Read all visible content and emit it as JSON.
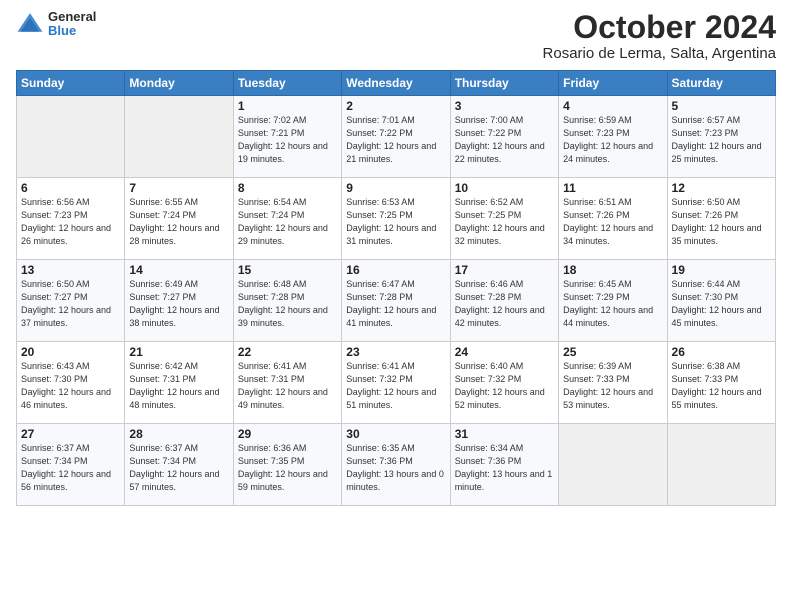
{
  "header": {
    "logo_general": "General",
    "logo_blue": "Blue",
    "title": "October 2024",
    "subtitle": "Rosario de Lerma, Salta, Argentina"
  },
  "weekdays": [
    "Sunday",
    "Monday",
    "Tuesday",
    "Wednesday",
    "Thursday",
    "Friday",
    "Saturday"
  ],
  "weeks": [
    [
      {
        "day": "",
        "info": ""
      },
      {
        "day": "",
        "info": ""
      },
      {
        "day": "1",
        "info": "Sunrise: 7:02 AM\nSunset: 7:21 PM\nDaylight: 12 hours and 19 minutes."
      },
      {
        "day": "2",
        "info": "Sunrise: 7:01 AM\nSunset: 7:22 PM\nDaylight: 12 hours and 21 minutes."
      },
      {
        "day": "3",
        "info": "Sunrise: 7:00 AM\nSunset: 7:22 PM\nDaylight: 12 hours and 22 minutes."
      },
      {
        "day": "4",
        "info": "Sunrise: 6:59 AM\nSunset: 7:23 PM\nDaylight: 12 hours and 24 minutes."
      },
      {
        "day": "5",
        "info": "Sunrise: 6:57 AM\nSunset: 7:23 PM\nDaylight: 12 hours and 25 minutes."
      }
    ],
    [
      {
        "day": "6",
        "info": "Sunrise: 6:56 AM\nSunset: 7:23 PM\nDaylight: 12 hours and 26 minutes."
      },
      {
        "day": "7",
        "info": "Sunrise: 6:55 AM\nSunset: 7:24 PM\nDaylight: 12 hours and 28 minutes."
      },
      {
        "day": "8",
        "info": "Sunrise: 6:54 AM\nSunset: 7:24 PM\nDaylight: 12 hours and 29 minutes."
      },
      {
        "day": "9",
        "info": "Sunrise: 6:53 AM\nSunset: 7:25 PM\nDaylight: 12 hours and 31 minutes."
      },
      {
        "day": "10",
        "info": "Sunrise: 6:52 AM\nSunset: 7:25 PM\nDaylight: 12 hours and 32 minutes."
      },
      {
        "day": "11",
        "info": "Sunrise: 6:51 AM\nSunset: 7:26 PM\nDaylight: 12 hours and 34 minutes."
      },
      {
        "day": "12",
        "info": "Sunrise: 6:50 AM\nSunset: 7:26 PM\nDaylight: 12 hours and 35 minutes."
      }
    ],
    [
      {
        "day": "13",
        "info": "Sunrise: 6:50 AM\nSunset: 7:27 PM\nDaylight: 12 hours and 37 minutes."
      },
      {
        "day": "14",
        "info": "Sunrise: 6:49 AM\nSunset: 7:27 PM\nDaylight: 12 hours and 38 minutes."
      },
      {
        "day": "15",
        "info": "Sunrise: 6:48 AM\nSunset: 7:28 PM\nDaylight: 12 hours and 39 minutes."
      },
      {
        "day": "16",
        "info": "Sunrise: 6:47 AM\nSunset: 7:28 PM\nDaylight: 12 hours and 41 minutes."
      },
      {
        "day": "17",
        "info": "Sunrise: 6:46 AM\nSunset: 7:28 PM\nDaylight: 12 hours and 42 minutes."
      },
      {
        "day": "18",
        "info": "Sunrise: 6:45 AM\nSunset: 7:29 PM\nDaylight: 12 hours and 44 minutes."
      },
      {
        "day": "19",
        "info": "Sunrise: 6:44 AM\nSunset: 7:30 PM\nDaylight: 12 hours and 45 minutes."
      }
    ],
    [
      {
        "day": "20",
        "info": "Sunrise: 6:43 AM\nSunset: 7:30 PM\nDaylight: 12 hours and 46 minutes."
      },
      {
        "day": "21",
        "info": "Sunrise: 6:42 AM\nSunset: 7:31 PM\nDaylight: 12 hours and 48 minutes."
      },
      {
        "day": "22",
        "info": "Sunrise: 6:41 AM\nSunset: 7:31 PM\nDaylight: 12 hours and 49 minutes."
      },
      {
        "day": "23",
        "info": "Sunrise: 6:41 AM\nSunset: 7:32 PM\nDaylight: 12 hours and 51 minutes."
      },
      {
        "day": "24",
        "info": "Sunrise: 6:40 AM\nSunset: 7:32 PM\nDaylight: 12 hours and 52 minutes."
      },
      {
        "day": "25",
        "info": "Sunrise: 6:39 AM\nSunset: 7:33 PM\nDaylight: 12 hours and 53 minutes."
      },
      {
        "day": "26",
        "info": "Sunrise: 6:38 AM\nSunset: 7:33 PM\nDaylight: 12 hours and 55 minutes."
      }
    ],
    [
      {
        "day": "27",
        "info": "Sunrise: 6:37 AM\nSunset: 7:34 PM\nDaylight: 12 hours and 56 minutes."
      },
      {
        "day": "28",
        "info": "Sunrise: 6:37 AM\nSunset: 7:34 PM\nDaylight: 12 hours and 57 minutes."
      },
      {
        "day": "29",
        "info": "Sunrise: 6:36 AM\nSunset: 7:35 PM\nDaylight: 12 hours and 59 minutes."
      },
      {
        "day": "30",
        "info": "Sunrise: 6:35 AM\nSunset: 7:36 PM\nDaylight: 13 hours and 0 minutes."
      },
      {
        "day": "31",
        "info": "Sunrise: 6:34 AM\nSunset: 7:36 PM\nDaylight: 13 hours and 1 minute."
      },
      {
        "day": "",
        "info": ""
      },
      {
        "day": "",
        "info": ""
      }
    ]
  ]
}
